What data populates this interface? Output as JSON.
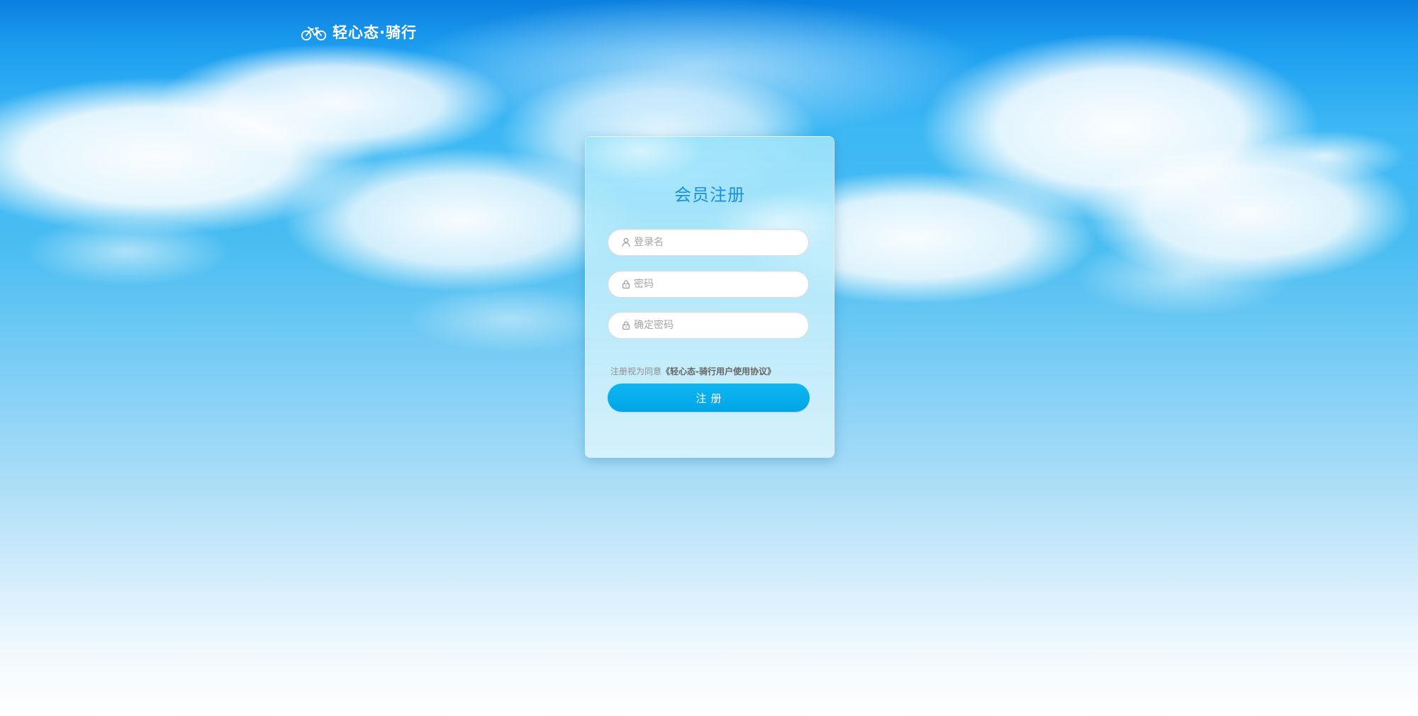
{
  "brand": {
    "name": "轻心态·骑行",
    "icon": "bicycle-icon"
  },
  "register": {
    "title": "会员注册",
    "fields": [
      {
        "name": "username",
        "icon": "user-icon",
        "placeholder": "登录名",
        "value": ""
      },
      {
        "name": "password",
        "icon": "lock-icon",
        "placeholder": "密码",
        "value": ""
      },
      {
        "name": "confirm_password",
        "icon": "lock-icon",
        "placeholder": "确定密码",
        "value": ""
      }
    ],
    "agreement_prefix": "注册视为同意",
    "agreement_link": "《轻心态-骑行用户使用协议》",
    "submit_label": "注册"
  },
  "colors": {
    "title": "#1b91da",
    "button": "#00a5e7",
    "background_top": "#0a7fdf",
    "background_bottom": "#ffffff"
  }
}
